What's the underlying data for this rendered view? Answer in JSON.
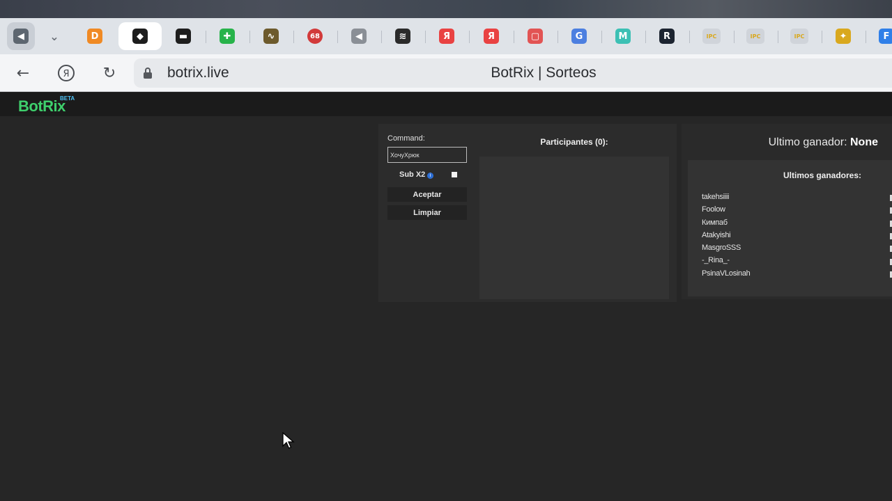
{
  "browser": {
    "tabs": [
      {
        "icon": "speaker-icon",
        "label": "◀",
        "color": "#5d6670"
      },
      {
        "icon": "chevron-down-icon",
        "label": "⌄",
        "color": "#6b7078"
      },
      {
        "icon": "d-logo-icon",
        "label": "D",
        "color": "#f08a24"
      },
      {
        "icon": "botrix-logo-icon",
        "label": "◆",
        "color": "#1d1d1d"
      },
      {
        "icon": "dark-site-icon",
        "label": "▬",
        "color": "#1e1e1e"
      },
      {
        "icon": "green-cross-icon",
        "label": "✚",
        "color": "#27b34a"
      },
      {
        "icon": "wave-icon",
        "label": "∿",
        "color": "#6d5a2c"
      },
      {
        "icon": "badge-count-icon",
        "label": "68",
        "color": "#d23a3a"
      },
      {
        "icon": "speaker-icon",
        "label": "◀",
        "color": "#8a8f96"
      },
      {
        "icon": "quill-icon",
        "label": "≋",
        "color": "#2a2a2a"
      },
      {
        "icon": "yandex-icon",
        "label": "Я",
        "color": "#e94242"
      },
      {
        "icon": "yandex-icon",
        "label": "Я",
        "color": "#e94242"
      },
      {
        "icon": "red-frame-icon",
        "label": "▢",
        "color": "#e25454"
      },
      {
        "icon": "translate-icon",
        "label": "G",
        "color": "#4c7fe0"
      },
      {
        "icon": "m-logo-icon",
        "label": "M",
        "color": "#3cc0b4"
      },
      {
        "icon": "r-logo-icon",
        "label": "R",
        "color": "#1c2430"
      },
      {
        "icon": "ipc-icon",
        "label": "IPC",
        "color": "#d0d4da"
      },
      {
        "icon": "ipc-icon",
        "label": "IPC",
        "color": "#d0d4da"
      },
      {
        "icon": "ipc-icon",
        "label": "IPC",
        "color": "#d0d4da"
      },
      {
        "icon": "ticket-icon",
        "label": "✦",
        "color": "#d9a81e"
      },
      {
        "icon": "f-logo-icon",
        "label": "F",
        "color": "#2f7fe8"
      }
    ],
    "url": "botrix.live",
    "page_title": "BotRix | Sorteos"
  },
  "site": {
    "logo": "BotRix",
    "badge": "BETA"
  },
  "giveaway": {
    "command_label": "Command:",
    "command_value": "ХочуХрюк",
    "sub_label": "Sub X2",
    "sub_checked": false,
    "accept_label": "Aceptar",
    "clear_label": "Limpiar",
    "participants_title": "Participantes (0):",
    "participants": []
  },
  "winners": {
    "last_label": "Ultimo ganador:",
    "last_value": "None",
    "list_title": "Ultimos ganadores:",
    "list": [
      "takehsiiii",
      "Foolow",
      "Кимпаб",
      "Atakyishi",
      "MasgroSSS",
      "-_Rina_-",
      "PsinaVLosinah"
    ]
  },
  "colors": {
    "logo_green": "#3ecf6c",
    "beta_blue": "#4fc3f7",
    "info_blue": "#2d6fd6"
  }
}
